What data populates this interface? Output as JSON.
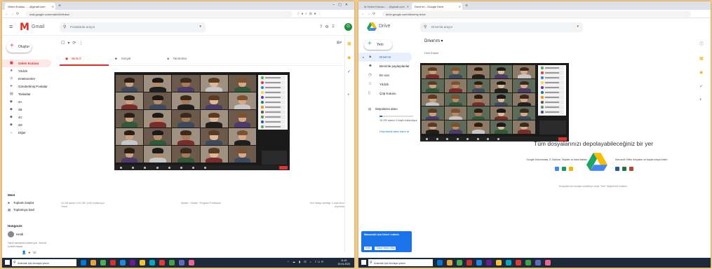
{
  "gmail": {
    "tabs": [
      {
        "label": "Gelen Kutusu - ...@gmail.com",
        "active": true
      },
      {
        "label": ""
      }
    ],
    "url": "mail.google.com/mail/u/0/#inbox",
    "app_name": "Gmail",
    "search_placeholder": "Postalarda arayın",
    "compose_label": "Oluştur",
    "nav": [
      {
        "icon": "inbox-icon",
        "glyph": "▣",
        "label": "Gelen Kutusu",
        "active": true
      },
      {
        "icon": "star-icon",
        "glyph": "★",
        "label": "Yıldızlı"
      },
      {
        "icon": "snooze-icon",
        "glyph": "◷",
        "label": "Ertelenenler"
      },
      {
        "icon": "send-icon",
        "glyph": "➤",
        "label": "Gönderilmiş Postalar"
      },
      {
        "icon": "draft-icon",
        "glyph": "▤",
        "label": "Taslaklar"
      },
      {
        "icon": "label-icon",
        "glyph": "◆",
        "label": "4A"
      },
      {
        "icon": "label-icon",
        "glyph": "◆",
        "label": "4B"
      },
      {
        "icon": "label-icon",
        "glyph": "◆",
        "label": "4C"
      },
      {
        "icon": "label-icon",
        "glyph": "◆",
        "label": "4D"
      },
      {
        "icon": "chevron-down-icon",
        "glyph": "⌄",
        "label": "Diğer"
      }
    ],
    "inbox_tabs": [
      {
        "icon": "inbox-icon",
        "glyph": "▣",
        "label": "Birincil",
        "active": true
      },
      {
        "icon": "people-icon",
        "glyph": "☻",
        "label": "Sosyal"
      },
      {
        "icon": "tag-icon",
        "glyph": "◈",
        "label": "Tanıtımlar"
      }
    ],
    "meet": {
      "title": "Meet",
      "items": [
        {
          "icon": "video-icon",
          "glyph": "■",
          "label": "Toplantı başlat"
        },
        {
          "icon": "keyboard-icon",
          "glyph": "▦",
          "label": "Toplantıya katıl"
        }
      ]
    },
    "hangouts": {
      "title": "Hangouts",
      "user": "Heidi",
      "note": "Yakın zamanda sohbet yok. Yeni bir sohbet başlat"
    },
    "footer": {
      "storage": "15 GB alanın 0,02 GB'ı (%0) kullanılıyor",
      "manage": "Yönet",
      "terms": "Şartlar · Gizlilik · Program Politikaları",
      "activity": "Son hesap etkinliği: 1 saat önce",
      "details": "Ayrıntılar"
    }
  },
  "drive": {
    "tabs": [
      {
        "label": "M Gelen Kutusu - ...@gmail.com"
      },
      {
        "label": "Drive'ım - Google Drive",
        "active": true
      }
    ],
    "url": "drive.google.com/drive/my-drive",
    "app_name": "Drive",
    "search_placeholder": "Drive'da arayın",
    "new_label": "Yeni",
    "nav": [
      {
        "icon": "my-drive-icon",
        "glyph": "▲",
        "label": "Drive'ım",
        "active": true
      },
      {
        "icon": "shared-icon",
        "glyph": "☻",
        "label": "Benimle paylaşılanlar"
      },
      {
        "icon": "recent-icon",
        "glyph": "◷",
        "label": "En son"
      },
      {
        "icon": "star-icon",
        "glyph": "☆",
        "label": "Yıldızlı"
      },
      {
        "icon": "trash-icon",
        "glyph": "▯",
        "label": "Çöp Kutusu"
      }
    ],
    "storage_label": "Depolama alanı",
    "storage_used": "15 GB alanın 0 baytı kullanılıyor",
    "buy_storage": "Depolama alanı satın al",
    "heading": "Drive'ım",
    "subheading": "Hızlı Erişim",
    "empty_title": "Tüm dosyalarınızı depolayabileceğiniz bir yer",
    "empty_left": "Google Dokümanlar, E-Tablolar, Slaytlar ve daha fazlası",
    "empty_right": "Microsoft Office dosyaları ve başka dosya türleri",
    "empty_foot": "Dosyalarınızı buraya sürükleyin veya \"Yeni\" düğmesini kullanın",
    "toast": {
      "title": "Masaüstü için Drive'ı edinin",
      "buttons": [
        "İndir",
        "Daha fazla bilgi"
      ]
    }
  },
  "taskbar": {
    "search_text": "Aramak için buraya yazın",
    "time": "11:42",
    "date": "29.04.2020"
  },
  "colors": {
    "gmail_red": "#d93025",
    "drive_blue": "#1a73e8",
    "taskbar": "#1c2a3a",
    "photo_bg": "#f3c98a"
  }
}
